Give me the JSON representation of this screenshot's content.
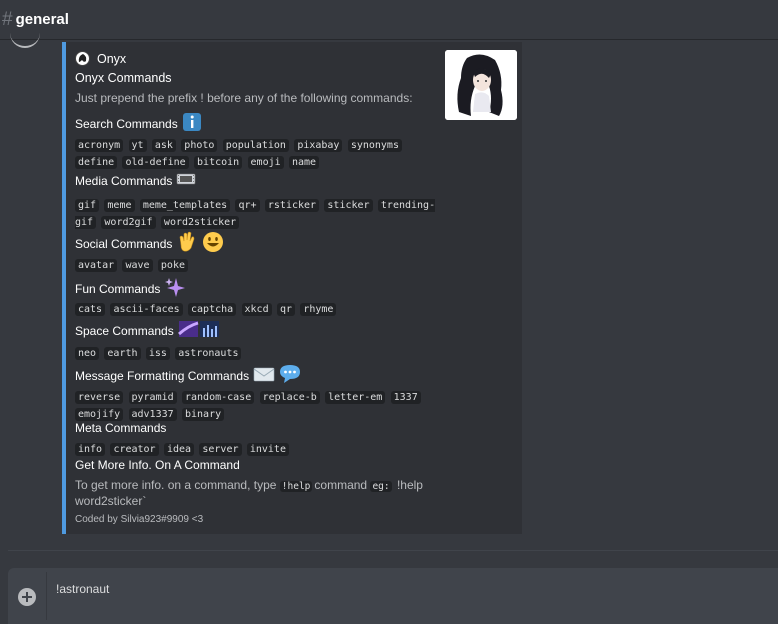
{
  "channel": {
    "hash": "#",
    "name": "general"
  },
  "embed": {
    "author": "Onyx",
    "title": "Onyx Commands",
    "description": "Just prepend the prefix ! before any of the following commands:",
    "accent_color": "#4f9ae0",
    "fields": [
      {
        "name": "Search Commands",
        "emoji": "info-icon",
        "commands": [
          "acronym",
          "yt",
          "ask",
          "photo",
          "population",
          "pixabay",
          "synonyms",
          "define",
          "old-define",
          "bitcoin",
          "emoji",
          "name"
        ]
      },
      {
        "name": "Media Commands",
        "emoji": "film-icon",
        "commands": [
          "gif",
          "meme",
          "meme_templates",
          "qr+",
          "rsticker",
          "sticker",
          "trending-gif",
          "word2gif",
          "word2sticker"
        ]
      },
      {
        "name": "Social Commands",
        "emoji": "wave-smile-icon",
        "commands": [
          "avatar",
          "wave",
          "poke"
        ]
      },
      {
        "name": "Fun Commands",
        "emoji": "sparkles-icon",
        "commands": [
          "cats",
          "ascii-faces",
          "captcha",
          "xkcd",
          "qr",
          "rhyme"
        ]
      },
      {
        "name": "Space Commands",
        "emoji": "galaxy-icon",
        "commands": [
          "neo",
          "earth",
          "iss",
          "astronauts"
        ]
      },
      {
        "name": "Message Formatting Commands",
        "emoji": "envelope-speech-icon",
        "commands": [
          "reverse",
          "pyramid",
          "random-case",
          "replace-b",
          "letter-em",
          "1337",
          "emojify",
          "adv1337",
          "binary"
        ]
      },
      {
        "name": "Meta Commands",
        "emoji": "",
        "commands": [
          "info",
          "creator",
          "idea",
          "server",
          "invite"
        ]
      }
    ],
    "more_info": {
      "name": "Get More Info. On A Command",
      "text_1": "To get more info. on a command, type",
      "code_1": "!help",
      "text_2": "command",
      "code_2": "eg:",
      "text_3": "!help",
      "text_4": "word2sticker`"
    },
    "footer": "Coded by Silvia923#9909 <3"
  },
  "input": {
    "value": "!astronaut"
  }
}
